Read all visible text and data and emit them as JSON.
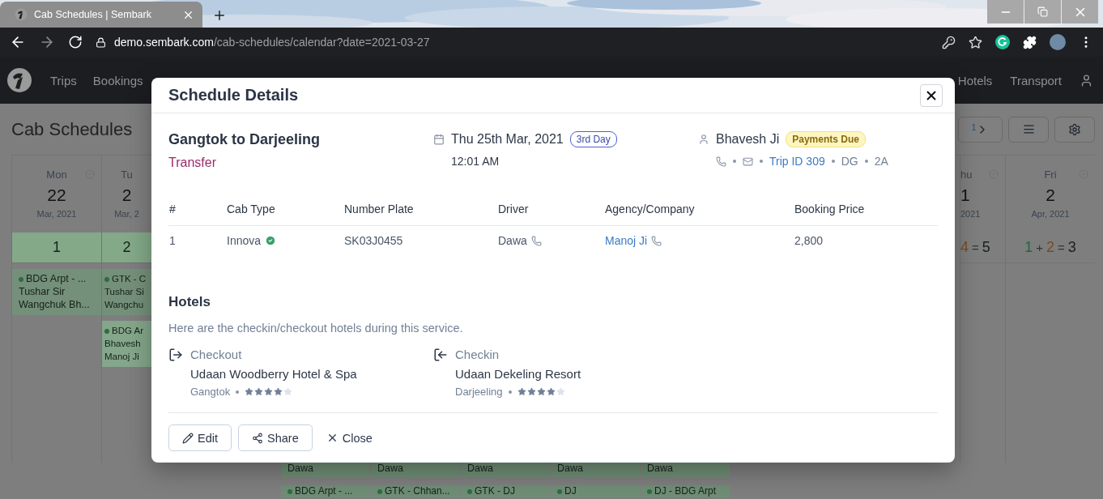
{
  "browser": {
    "tab_title": "Cab Schedules | Sembark",
    "url_host": "demo.sembark.com",
    "url_path": "/cab-schedules/calendar?date=2021-03-27"
  },
  "navbar": {
    "left": [
      {
        "label": "Trips"
      },
      {
        "label": "Bookings"
      }
    ],
    "right": [
      {
        "label": "Hotels"
      },
      {
        "label": "Transport"
      }
    ]
  },
  "page": {
    "title": "Cab Schedules",
    "pager_count": "1"
  },
  "calendar_left": [
    {
      "day": "Mon",
      "date": "22",
      "month": "Mar, 2021",
      "highlighted": true,
      "summary": [
        {
          "kind": "total",
          "text": "1"
        }
      ],
      "events": [
        {
          "lines": [
            "BDG Arpt - ...",
            "Tushar Sir",
            "Wangchuk Bh..."
          ]
        }
      ]
    },
    {
      "day": "Tu",
      "date": "2",
      "month": "Mar, 2",
      "highlighted": true,
      "summary": [
        {
          "kind": "total",
          "text": "2"
        }
      ],
      "events": [
        {
          "lines": [
            "GTK - C",
            "Tushar Si",
            "Wangchu"
          ]
        },
        {
          "lines": [
            "BDG Ar",
            "Bhavesh",
            "Manoj Ji"
          ]
        }
      ]
    }
  ],
  "calendar_right": [
    {
      "day": "hu",
      "date": "1",
      "month": "2021",
      "highlighted": false,
      "summary": [
        {
          "kind": "pending",
          "text": "4"
        },
        {
          "kind": "op",
          "text": "="
        },
        {
          "kind": "total",
          "text": "5"
        }
      ]
    },
    {
      "day": "Fri",
      "date": "2",
      "month": "Apr, 2021",
      "highlighted": false,
      "summary": [
        {
          "kind": "confirmed",
          "text": "1"
        },
        {
          "kind": "op",
          "text": "+"
        },
        {
          "kind": "pending",
          "text": "2"
        },
        {
          "kind": "op",
          "text": "="
        },
        {
          "kind": "total",
          "text": "3"
        }
      ]
    }
  ],
  "calendar_bottom": {
    "drivers": [
      "Dawa",
      "Dawa",
      "Dawa",
      "Dawa",
      "Dawa"
    ],
    "events": [
      "BDG Arpt - ...",
      "GTK - Chhan...",
      "GTK - DJ",
      "DJ",
      "DJ - BDG Arpt"
    ]
  },
  "modal": {
    "title": "Schedule Details",
    "route": "Gangtok to Darjeeling",
    "service_type": "Transfer",
    "date": "Thu 25th Mar, 2021",
    "day_badge": "3rd Day",
    "time": "12:01 AM",
    "guest": "Bhavesh Ji",
    "payment_badge": "Payments Due",
    "trip_id": "Trip ID 309",
    "meta": [
      "DG",
      "2A"
    ],
    "table": {
      "columns": [
        "#",
        "Cab Type",
        "Number Plate",
        "Driver",
        "Agency/Company",
        "Booking Price"
      ],
      "rows": [
        {
          "index": "1",
          "cab_type": "Innova",
          "verified": true,
          "number_plate": "SK03J0455",
          "driver": "Dawa",
          "agency": "Manoj Ji",
          "price": "2,800"
        }
      ]
    },
    "hotels": {
      "title": "Hotels",
      "description": "Here are the checkin/checkout hotels during this service.",
      "stays": [
        {
          "kind": "checkout",
          "label": "Checkout",
          "name": "Udaan Woodberry Hotel & Spa",
          "city": "Gangtok",
          "stars": 4
        },
        {
          "kind": "checkin",
          "label": "Checkin",
          "name": "Udaan Dekeling Resort",
          "city": "Darjeeling",
          "stars": 4
        }
      ]
    },
    "actions": [
      {
        "kind": "edit",
        "label": "Edit"
      },
      {
        "kind": "share",
        "label": "Share"
      },
      {
        "kind": "close",
        "label": "Close"
      }
    ]
  }
}
